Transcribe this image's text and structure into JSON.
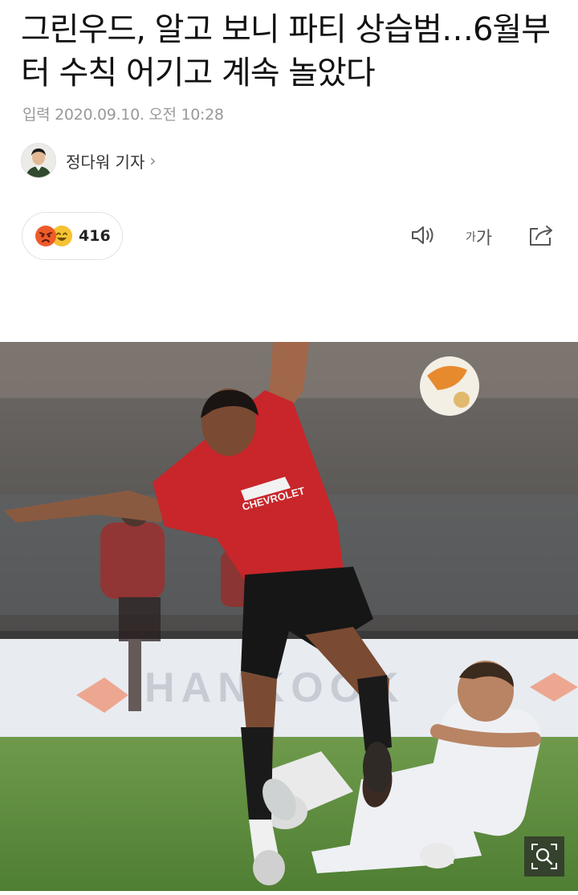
{
  "article": {
    "headline": "그린우드, 알고 보니 파티 상습범…6월부터 수칙 어기고 계속 놀았다",
    "published": "입력 2020.09.10. 오전 10:28"
  },
  "reporter": {
    "name": "정다워 기자",
    "chevron": "›"
  },
  "reactions": {
    "count": "416",
    "emojis": [
      "angry-face-icon",
      "laughing-face-icon"
    ],
    "colors": {
      "angry": "#ee5b2b",
      "laugh": "#f4c232"
    }
  },
  "toolbar": {
    "font_size_small": "가",
    "font_size_large": "가",
    "icons": [
      "speaker-icon",
      "font-size-icon",
      "share-icon"
    ]
  },
  "photo": {
    "banner_text": "HANKOOK",
    "shirt_sponsor": "CHEVROLET",
    "zoom_icon": "zoom-search-icon"
  }
}
